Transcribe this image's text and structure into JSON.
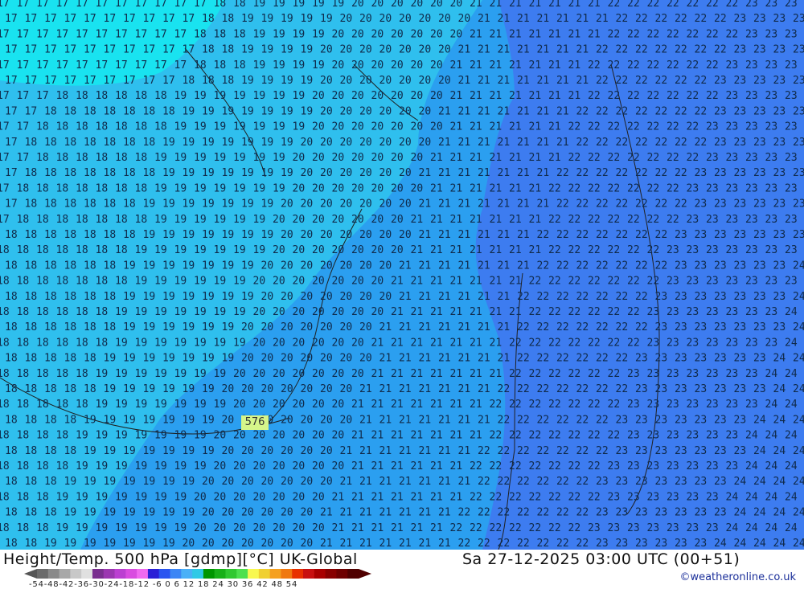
{
  "map": {
    "title": "Height/Temp. 500 hPa [gdmp][°C] UK-Global",
    "valid_time": "Sa 27-12-2025 03:00 UTC (00+51)",
    "credit": "©weatheronline.co.uk",
    "height_label": "576",
    "legend": {
      "ticks": "-54-48-42-36-30-24-18-12 -6  0  6  12 18 24 30 36 42 48 54",
      "colors": [
        "#6b6b6b",
        "#8a8a8a",
        "#a8a8a8",
        "#c8c8c8",
        "#e0e0e0",
        "#7a2f8f",
        "#9b36b0",
        "#bb3fd1",
        "#d94ce0",
        "#f06af0",
        "#2a1fd6",
        "#2a55f0",
        "#3c86f5",
        "#4ab0f7",
        "#2fc9e6",
        "#009600",
        "#18b018",
        "#30c830",
        "#4ee04e",
        "#f8f850",
        "#f0d030",
        "#f5a020",
        "#f07810",
        "#e83000",
        "#c81010",
        "#a80000",
        "#880000",
        "#6e0000",
        "#500000"
      ]
    },
    "regions": {
      "cyan": "#19e3f0",
      "sky": "#2fbfee",
      "azure": "#2b9ff0",
      "blue": "#3d7cf0"
    },
    "contour_values": [
      "17",
      "18",
      "19",
      "20",
      "21",
      "22",
      "23",
      "24"
    ]
  }
}
